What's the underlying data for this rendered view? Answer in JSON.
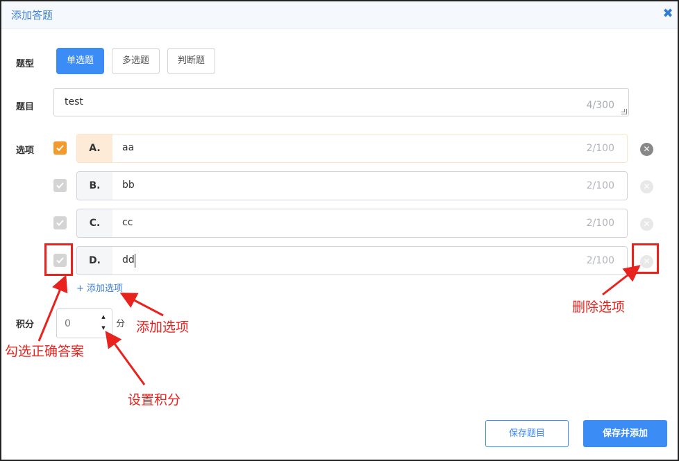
{
  "dialog": {
    "title": "添加答题",
    "close_icon": "close-icon"
  },
  "type_row": {
    "label": "题型",
    "buttons": [
      {
        "label": "单选题",
        "active": true
      },
      {
        "label": "多选题",
        "active": false
      },
      {
        "label": "判断题",
        "active": false
      }
    ]
  },
  "question_row": {
    "label": "题目",
    "value": "test",
    "count": "4/300"
  },
  "options_row": {
    "label": "选项",
    "items": [
      {
        "letter": "A.",
        "value": "aa",
        "count": "2/100",
        "correct": true
      },
      {
        "letter": "B.",
        "value": "bb",
        "count": "2/100",
        "correct": false
      },
      {
        "letter": "C.",
        "value": "cc",
        "count": "2/100",
        "correct": false
      },
      {
        "letter": "D.",
        "value": "dd",
        "count": "2/100",
        "correct": false
      }
    ],
    "add_label": "+ 添加选项"
  },
  "score_row": {
    "label": "积分",
    "value": "0",
    "unit": "分"
  },
  "footer": {
    "save_label": "保存题目",
    "save_add_label": "保存并添加"
  },
  "annotations": {
    "add_option": "添加选项",
    "delete_option": "删除选项",
    "check_correct": "勾选正确答案",
    "set_score": "设置积分",
    "color": "#e8231e"
  },
  "colors": {
    "primary": "#3c8cf6",
    "correct": "#f39a2d",
    "title": "#3d7fd8"
  }
}
